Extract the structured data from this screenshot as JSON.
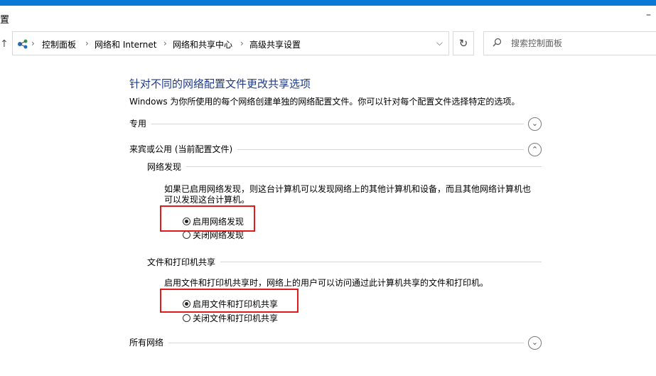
{
  "window": {
    "title_fragment": "置",
    "minimize_glyph": "–"
  },
  "address_bar": {
    "crumbs": [
      "控制面板",
      "网络和 Internet",
      "网络和共享中心",
      "高级共享设置"
    ],
    "separator": "›",
    "dropdown_glyph": "⌵",
    "refresh_glyph": "↻",
    "up_glyph": "↑"
  },
  "search": {
    "placeholder": "搜索控制面板",
    "icon": "search-icon"
  },
  "page": {
    "title": "针对不同的网络配置文件更改共享选项",
    "description": "Windows 为你所使用的每个网络创建单独的网络配置文件。你可以针对每个配置文件选择特定的选项。"
  },
  "profiles": {
    "private": {
      "label": "专用",
      "expanded": false,
      "toggle_glyph": "⌄"
    },
    "guest_public": {
      "label": "来宾或公用 (当前配置文件)",
      "expanded": true,
      "toggle_glyph": "⌃",
      "network_discovery": {
        "heading": "网络发现",
        "description_line1": "如果已启用网络发现，则这台计算机可以发现网络上的其他计算机和设备，而且其他网络计算机也",
        "description_line2": "可以发现这台计算机。",
        "option_on": "启用网络发现",
        "option_off": "关闭网络发现",
        "selected": "on"
      },
      "file_printer_sharing": {
        "heading": "文件和打印机共享",
        "description": "启用文件和打印机共享时，网络上的用户可以访问通过此计算机共享的文件和打印机。",
        "option_on": "启用文件和打印机共享",
        "option_off": "关闭文件和打印机共享",
        "selected": "on"
      }
    },
    "all_networks": {
      "label": "所有网络",
      "expanded": false,
      "toggle_glyph": "⌄"
    }
  },
  "colors": {
    "accent": "#0a78d7",
    "title_blue": "#1e3a8a",
    "highlight_red": "#e11b1b"
  }
}
